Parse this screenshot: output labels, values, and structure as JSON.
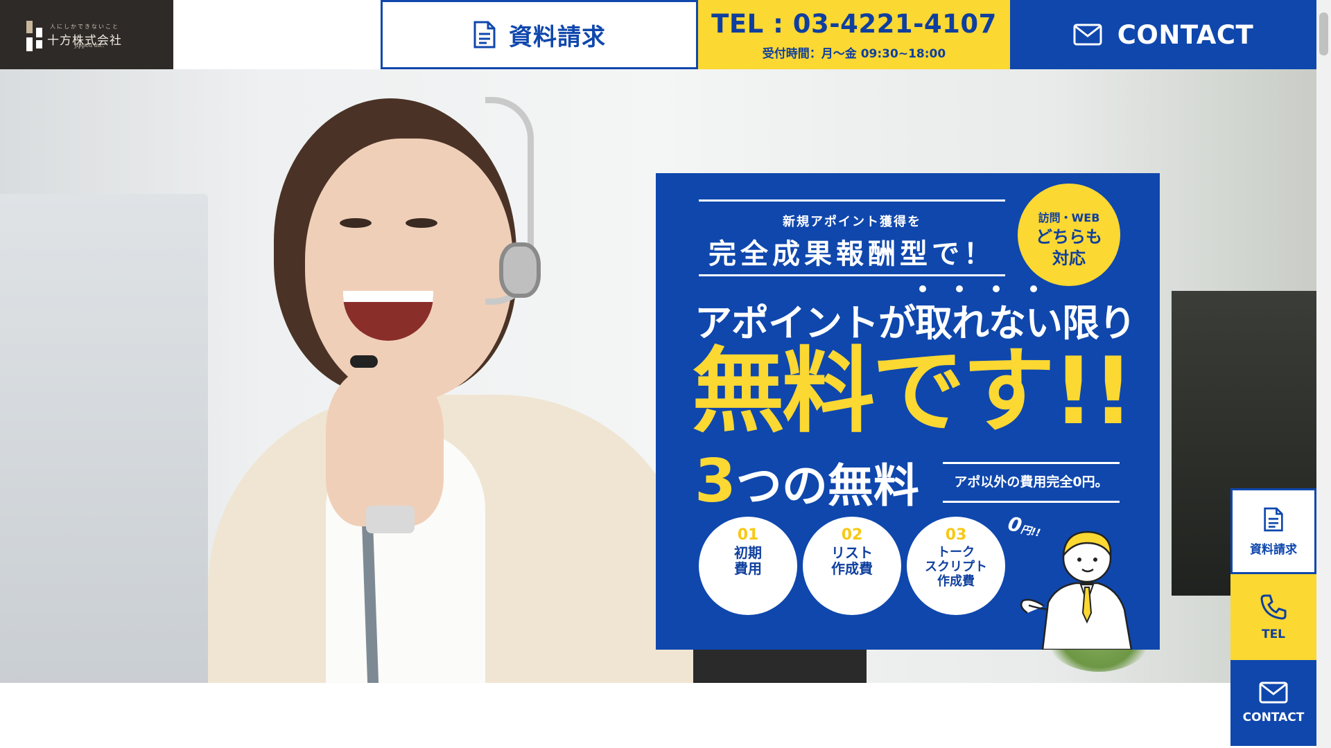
{
  "header": {
    "logo": {
      "tagline": "人にしかできないこと",
      "name": "十方株式会社",
      "en": "jippou inc."
    },
    "doc_button": {
      "label": "資料請求",
      "icon": "document-icon"
    },
    "tel": {
      "number": "TEL : 03-4221-4107",
      "hours": "受付時間：月〜金 09:30~18:00"
    },
    "contact_button": {
      "label": "CONTACT",
      "icon": "mail-icon"
    }
  },
  "hero": {
    "card": {
      "subtitle": "新規アポイント獲得を",
      "headline": "完全成果報酬型で！",
      "badge": {
        "line1": "訪問・WEB",
        "line2": "どちらも",
        "line3": "対応"
      },
      "main_line1": "アポイントが取れない限り",
      "main_line2": "無料です!!",
      "free_count_num": "3",
      "free_count_text": "つの無料",
      "right_text": "アポ以外の費用完全0円。",
      "items": [
        {
          "no": "01",
          "text": "初期\n費用"
        },
        {
          "no": "02",
          "text": "リスト\n作成費"
        },
        {
          "no": "03",
          "text": "トーク\nスクリプト\n作成費"
        }
      ],
      "zero_big": "0",
      "zero_small": "円!!"
    }
  },
  "side_nav": [
    {
      "label": "資料請求",
      "icon": "document-icon"
    },
    {
      "label": "TEL",
      "icon": "phone-icon"
    },
    {
      "label": "CONTACT",
      "icon": "mail-icon"
    }
  ],
  "colors": {
    "primary": "#0f47ad",
    "accent": "#fbd832",
    "logo_bg": "#2e2a27"
  }
}
